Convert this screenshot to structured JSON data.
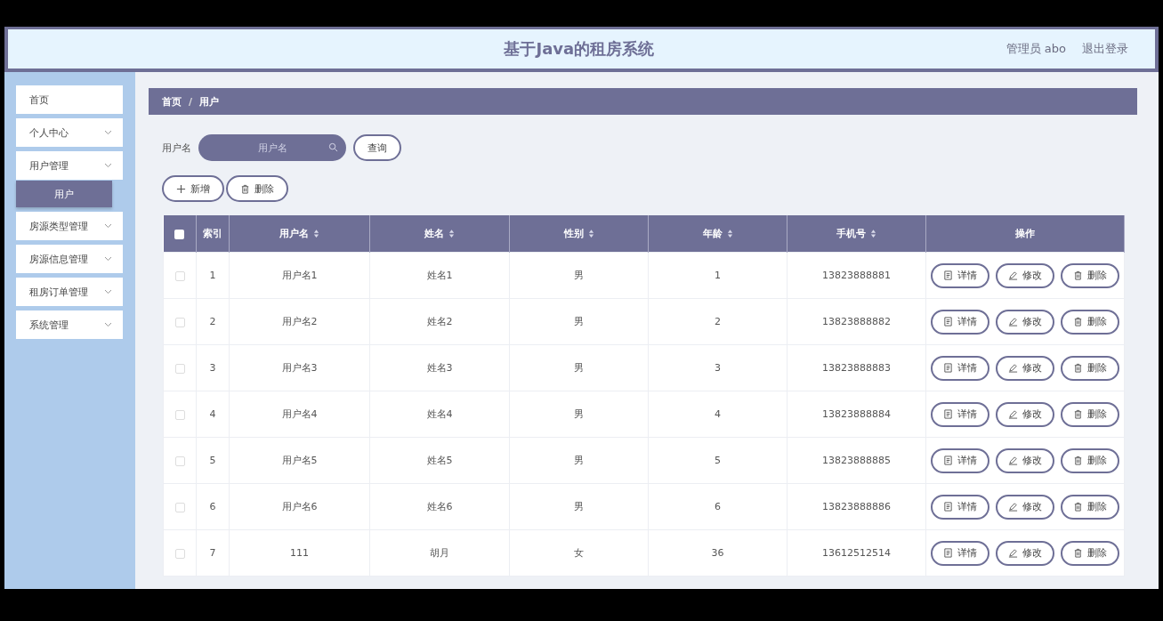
{
  "header": {
    "title": "基于Java的租房系统",
    "user": "管理员 abo",
    "logout": "退出登录"
  },
  "sidebar": {
    "items": [
      {
        "label": "首页",
        "kind": "link",
        "selected": false
      },
      {
        "label": "个人中心",
        "kind": "menu",
        "selected": false
      },
      {
        "label": "用户管理",
        "kind": "menu",
        "selected": false,
        "children": [
          {
            "label": "用户",
            "selected": true
          }
        ]
      },
      {
        "label": "房源类型管理",
        "kind": "menu",
        "selected": false
      },
      {
        "label": "房源信息管理",
        "kind": "menu",
        "selected": false
      },
      {
        "label": "租房订单管理",
        "kind": "menu",
        "selected": false
      },
      {
        "label": "系统管理",
        "kind": "menu",
        "selected": false
      }
    ]
  },
  "breadcrumb": {
    "items": [
      "首页",
      "用户"
    ],
    "separator": "/"
  },
  "search": {
    "label": "用户名",
    "placeholder": "用户名",
    "button": "查询"
  },
  "toolbar": [
    {
      "label": "新增",
      "kind": "add"
    },
    {
      "label": "删除",
      "kind": "delete"
    }
  ],
  "table": {
    "select_all": {
      "checked": false
    },
    "columns": [
      {
        "label": "索引",
        "sortable": false
      },
      {
        "label": "用户名",
        "sortable": true
      },
      {
        "label": "姓名",
        "sortable": true
      },
      {
        "label": "性别",
        "sortable": true
      },
      {
        "label": "年龄",
        "sortable": true
      },
      {
        "label": "手机号",
        "sortable": true
      },
      {
        "label": "操作",
        "sortable": false
      }
    ],
    "rows": [
      {
        "checked": false,
        "cells": [
          "1",
          "用户名1",
          "姓名1",
          "男",
          "1",
          "13823888881"
        ],
        "actions": [
          {
            "label": "详情",
            "kind": "detail"
          },
          {
            "label": "修改",
            "kind": "edit"
          },
          {
            "label": "删除",
            "kind": "delete"
          }
        ]
      },
      {
        "checked": false,
        "cells": [
          "2",
          "用户名2",
          "姓名2",
          "男",
          "2",
          "13823888882"
        ],
        "actions": [
          {
            "label": "详情",
            "kind": "detail"
          },
          {
            "label": "修改",
            "kind": "edit"
          },
          {
            "label": "删除",
            "kind": "delete"
          }
        ]
      },
      {
        "checked": false,
        "cells": [
          "3",
          "用户名3",
          "姓名3",
          "男",
          "3",
          "13823888883"
        ],
        "actions": [
          {
            "label": "详情",
            "kind": "detail"
          },
          {
            "label": "修改",
            "kind": "edit"
          },
          {
            "label": "删除",
            "kind": "delete"
          }
        ]
      },
      {
        "checked": false,
        "cells": [
          "4",
          "用户名4",
          "姓名4",
          "男",
          "4",
          "13823888884"
        ],
        "actions": [
          {
            "label": "详情",
            "kind": "detail"
          },
          {
            "label": "修改",
            "kind": "edit"
          },
          {
            "label": "删除",
            "kind": "delete"
          }
        ]
      },
      {
        "checked": false,
        "cells": [
          "5",
          "用户名5",
          "姓名5",
          "男",
          "5",
          "13823888885"
        ],
        "actions": [
          {
            "label": "详情",
            "kind": "detail"
          },
          {
            "label": "修改",
            "kind": "edit"
          },
          {
            "label": "删除",
            "kind": "delete"
          }
        ]
      },
      {
        "checked": false,
        "cells": [
          "6",
          "用户名6",
          "姓名6",
          "男",
          "6",
          "13823888886"
        ],
        "actions": [
          {
            "label": "详情",
            "kind": "detail"
          },
          {
            "label": "修改",
            "kind": "edit"
          },
          {
            "label": "删除",
            "kind": "delete"
          }
        ]
      },
      {
        "checked": false,
        "cells": [
          "7",
          "111",
          "胡月",
          "女",
          "36",
          "13612512514"
        ],
        "actions": [
          {
            "label": "详情",
            "kind": "detail"
          },
          {
            "label": "修改",
            "kind": "edit"
          },
          {
            "label": "删除",
            "kind": "delete"
          }
        ]
      }
    ]
  }
}
